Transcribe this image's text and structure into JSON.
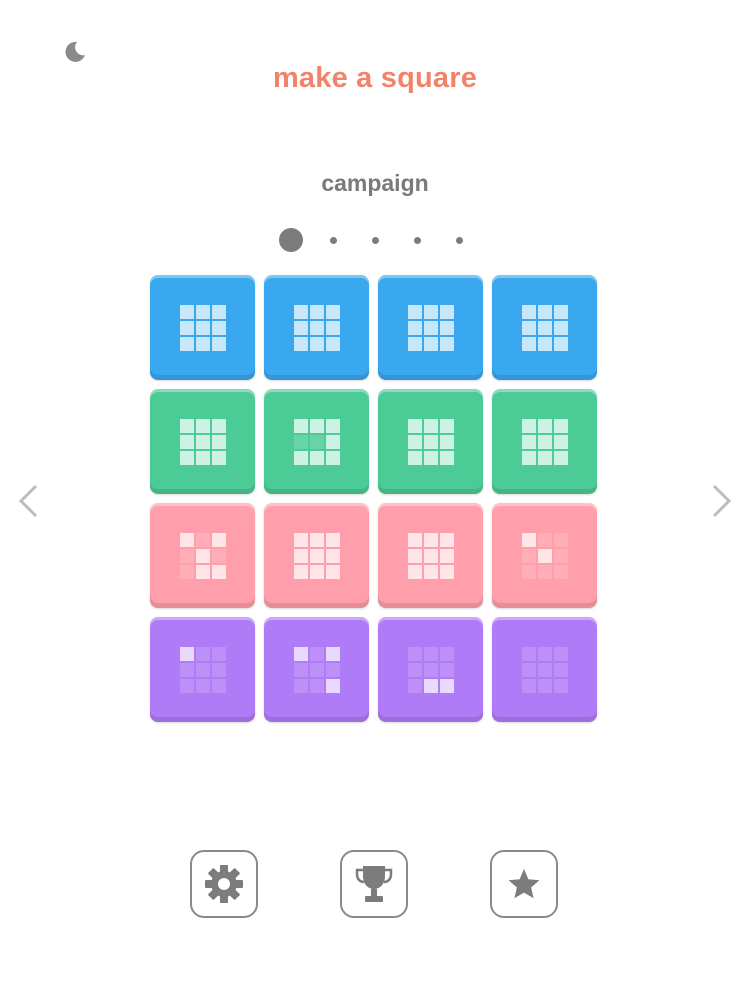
{
  "header": {
    "title": "make a square",
    "title_color": "#f2836b",
    "theme_toggle_icon": "moon-icon"
  },
  "mode": {
    "label": "campaign"
  },
  "pager": {
    "pages": 5,
    "current": 1
  },
  "colors": {
    "blue": "#3aa8ef",
    "green": "#4ccb96",
    "pink": "#ff9fab",
    "purple": "#b07bf6",
    "icon_gray": "#7c7c7c"
  },
  "levels": [
    {
      "color": "blue",
      "pattern": [
        1,
        1,
        1,
        1,
        1,
        1,
        1,
        1,
        1
      ]
    },
    {
      "color": "blue",
      "pattern": [
        1,
        1,
        1,
        1,
        1,
        1,
        1,
        1,
        1
      ]
    },
    {
      "color": "blue",
      "pattern": [
        1,
        1,
        1,
        1,
        1,
        1,
        1,
        1,
        1
      ]
    },
    {
      "color": "blue",
      "pattern": [
        1,
        1,
        1,
        1,
        1,
        1,
        1,
        1,
        1
      ]
    },
    {
      "color": "green",
      "pattern": [
        1,
        1,
        1,
        1,
        1,
        1,
        1,
        1,
        1
      ]
    },
    {
      "color": "green",
      "pattern": [
        1,
        1,
        1,
        0,
        0,
        1,
        1,
        1,
        1
      ]
    },
    {
      "color": "green",
      "pattern": [
        1,
        1,
        1,
        1,
        1,
        1,
        1,
        1,
        1
      ]
    },
    {
      "color": "green",
      "pattern": [
        1,
        1,
        1,
        1,
        1,
        1,
        1,
        1,
        1
      ]
    },
    {
      "color": "pink",
      "pattern": [
        1,
        0,
        1,
        0,
        1,
        0,
        0,
        1,
        1
      ]
    },
    {
      "color": "pink",
      "pattern": [
        1,
        1,
        1,
        1,
        1,
        1,
        1,
        1,
        1
      ]
    },
    {
      "color": "pink",
      "pattern": [
        1,
        1,
        1,
        1,
        1,
        1,
        1,
        1,
        1
      ]
    },
    {
      "color": "pink",
      "pattern": [
        1,
        0,
        0,
        0,
        1,
        0,
        0,
        0,
        0
      ]
    },
    {
      "color": "purple",
      "pattern": [
        1,
        0,
        0,
        0,
        0,
        0,
        0,
        0,
        0
      ]
    },
    {
      "color": "purple",
      "pattern": [
        1,
        0,
        1,
        0,
        0,
        0,
        0,
        0,
        1
      ]
    },
    {
      "color": "purple",
      "pattern": [
        0,
        0,
        0,
        0,
        0,
        0,
        0,
        1,
        1
      ]
    },
    {
      "color": "purple",
      "pattern": [
        0,
        0,
        0,
        0,
        0,
        0,
        0,
        0,
        0
      ]
    }
  ],
  "navigation": {
    "prev_icon": "chevron-left-icon",
    "next_icon": "chevron-right-icon"
  },
  "toolbar": {
    "settings_icon": "gear-icon",
    "leaderboard_icon": "trophy-icon",
    "rate_icon": "star-icon"
  }
}
